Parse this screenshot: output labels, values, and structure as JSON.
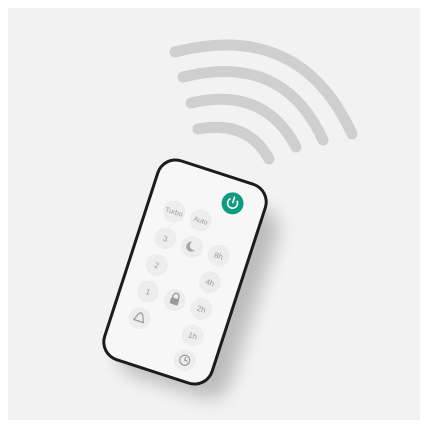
{
  "image": {
    "subject": "handheld IR remote control emitting signal waves",
    "colors": {
      "background": "#f2f2f2",
      "remote_body": "#f7f7f7",
      "remote_bezel": "#1c1c1c",
      "button_face": "#ededed",
      "power_button": "#0f9b7f",
      "wave_color": "#cfcfcf",
      "label_color": "#9a9a9a"
    }
  },
  "remote": {
    "buttons": {
      "power": {
        "icon": "power-icon"
      },
      "turbo": {
        "label": "Turbo"
      },
      "auto": {
        "label": "Auto"
      },
      "speed_3": {
        "label": "3"
      },
      "sleep": {
        "icon": "moon-icon"
      },
      "timer_8h": {
        "label": "8h"
      },
      "speed_2": {
        "label": "2"
      },
      "timer_4h": {
        "label": "4h"
      },
      "speed_1": {
        "label": "1"
      },
      "lock": {
        "icon": "lock-icon"
      },
      "timer_2h": {
        "label": "2h"
      },
      "filter": {
        "icon": "filter-icon"
      },
      "timer_1h": {
        "label": "1h"
      },
      "timer": {
        "icon": "clock-icon"
      }
    }
  }
}
